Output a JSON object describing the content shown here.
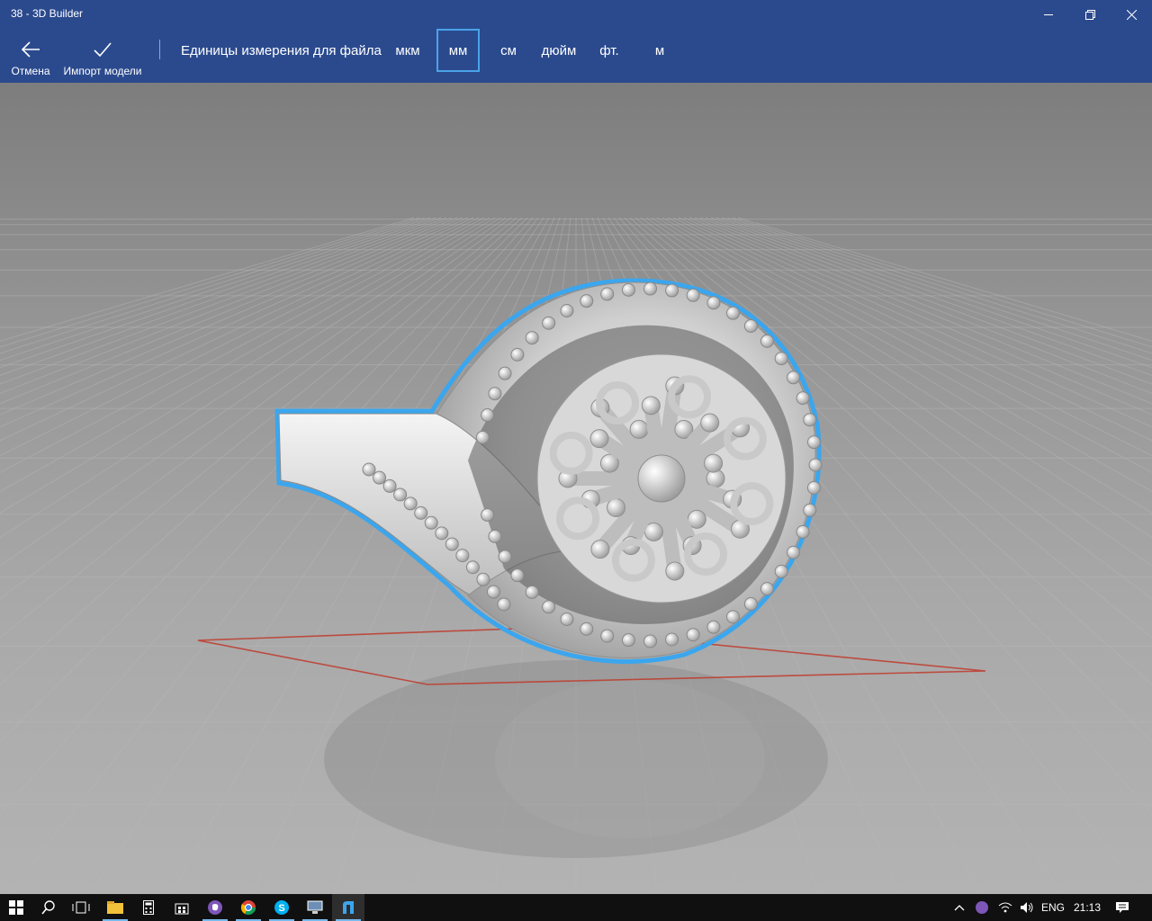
{
  "window": {
    "title": "38 - 3D Builder"
  },
  "toolbar": {
    "cancel_label": "Отмена",
    "import_label": "Импорт модели",
    "units_label": "Единицы измерения для файла",
    "units": [
      "мкм",
      "мм",
      "см",
      "дюйм",
      "фт.",
      "м"
    ],
    "selected_unit": "мм"
  },
  "colors": {
    "accent": "#2b4a8e",
    "selection": "#4aa3e8",
    "bed_outline": "#c03a2b"
  },
  "taskbar": {
    "apps": [
      "file-explorer-icon",
      "calculator-icon",
      "store-icon",
      "viber-icon",
      "chrome-icon",
      "skype-icon",
      "remote-desktop-icon",
      "3d-builder-icon"
    ],
    "language": "ENG",
    "time": "21:13"
  }
}
